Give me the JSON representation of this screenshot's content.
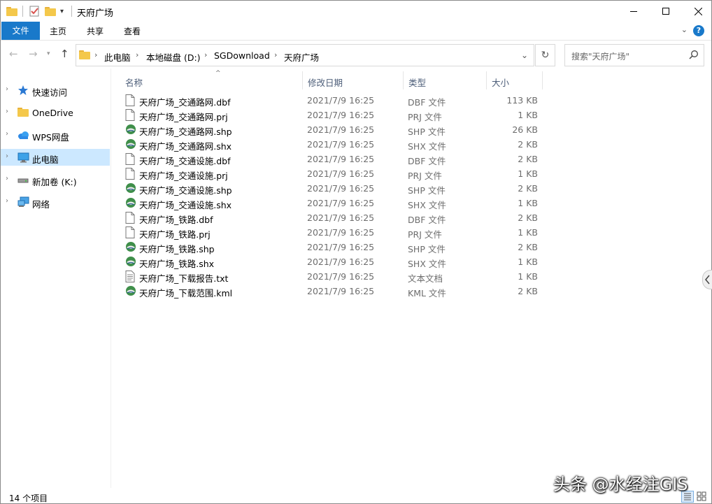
{
  "window": {
    "title": "天府广场",
    "minimize_icon": "minimize-icon",
    "maximize_icon": "maximize-icon",
    "close_icon": "close-icon"
  },
  "ribbon": {
    "tabs": [
      "文件",
      "主页",
      "共享",
      "查看"
    ],
    "help": "?"
  },
  "address": {
    "breadcrumbs": [
      "此电脑",
      "本地磁盘 (D:)",
      "SGDownload",
      "天府广场"
    ],
    "search_placeholder": "搜索\"天府广场\""
  },
  "sidebar": {
    "items": [
      {
        "label": "快速访问",
        "icon": "star-icon"
      },
      {
        "label": "OneDrive",
        "icon": "folder-icon"
      },
      {
        "label": "WPS网盘",
        "icon": "cloud-icon"
      },
      {
        "label": "此电脑",
        "icon": "computer-icon",
        "selected": true
      },
      {
        "label": "新加卷 (K:)",
        "icon": "drive-icon"
      },
      {
        "label": "网络",
        "icon": "network-icon"
      }
    ]
  },
  "columns": [
    "名称",
    "修改日期",
    "类型",
    "大小"
  ],
  "files": [
    {
      "name": "天府广场_交通路网.dbf",
      "date": "2021/7/9 16:25",
      "type": "DBF 文件",
      "size": "113 KB",
      "icon": "file-icon"
    },
    {
      "name": "天府广场_交通路网.prj",
      "date": "2021/7/9 16:25",
      "type": "PRJ 文件",
      "size": "1 KB",
      "icon": "file-icon"
    },
    {
      "name": "天府广场_交通路网.shp",
      "date": "2021/7/9 16:25",
      "type": "SHP 文件",
      "size": "26 KB",
      "icon": "globe-icon"
    },
    {
      "name": "天府广场_交通路网.shx",
      "date": "2021/7/9 16:25",
      "type": "SHX 文件",
      "size": "2 KB",
      "icon": "globe-icon"
    },
    {
      "name": "天府广场_交通设施.dbf",
      "date": "2021/7/9 16:25",
      "type": "DBF 文件",
      "size": "2 KB",
      "icon": "file-icon"
    },
    {
      "name": "天府广场_交通设施.prj",
      "date": "2021/7/9 16:25",
      "type": "PRJ 文件",
      "size": "1 KB",
      "icon": "file-icon"
    },
    {
      "name": "天府广场_交通设施.shp",
      "date": "2021/7/9 16:25",
      "type": "SHP 文件",
      "size": "2 KB",
      "icon": "globe-icon"
    },
    {
      "name": "天府广场_交通设施.shx",
      "date": "2021/7/9 16:25",
      "type": "SHX 文件",
      "size": "1 KB",
      "icon": "globe-icon"
    },
    {
      "name": "天府广场_铁路.dbf",
      "date": "2021/7/9 16:25",
      "type": "DBF 文件",
      "size": "2 KB",
      "icon": "file-icon"
    },
    {
      "name": "天府广场_铁路.prj",
      "date": "2021/7/9 16:25",
      "type": "PRJ 文件",
      "size": "1 KB",
      "icon": "file-icon"
    },
    {
      "name": "天府广场_铁路.shp",
      "date": "2021/7/9 16:25",
      "type": "SHP 文件",
      "size": "2 KB",
      "icon": "globe-icon"
    },
    {
      "name": "天府广场_铁路.shx",
      "date": "2021/7/9 16:25",
      "type": "SHX 文件",
      "size": "1 KB",
      "icon": "globe-icon"
    },
    {
      "name": "天府广场_下载报告.txt",
      "date": "2021/7/9 16:25",
      "type": "文本文档",
      "size": "1 KB",
      "icon": "text-file-icon"
    },
    {
      "name": "天府广场_下载范围.kml",
      "date": "2021/7/9 16:25",
      "type": "KML 文件",
      "size": "2 KB",
      "icon": "globe-icon"
    }
  ],
  "status": {
    "item_count": "14 个项目"
  },
  "watermark": "头条 @水经注GIS",
  "colors": {
    "accent": "#1979ca",
    "selection": "#cce8ff",
    "header_text": "#4d5e79"
  }
}
